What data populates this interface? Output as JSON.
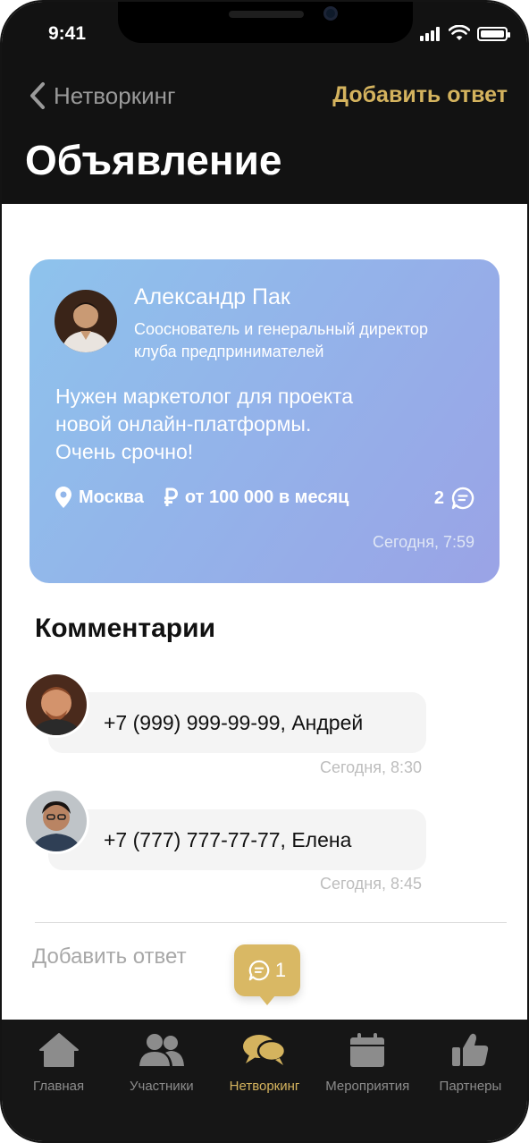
{
  "status_bar": {
    "time": "9:41"
  },
  "nav": {
    "back_label": "Нетворкинг",
    "action_label": "Добавить ответ",
    "title": "Объявление"
  },
  "post": {
    "author_name": "Александр Пак",
    "author_role": "Сооснователь и генеральный директор клуба предпринимателей",
    "text_lines": [
      "Нужен маркетолог для проекта",
      "новой онлайн-платформы.",
      "Очень срочно!"
    ],
    "location": "Москва",
    "salary": "от 100 000 в месяц",
    "comments_count": "2",
    "date": "Сегодня, 7:59",
    "icons": [
      "location-pin-icon",
      "ruble-icon",
      "comment-icon"
    ]
  },
  "comments": {
    "title": "Комментарии",
    "items": [
      {
        "text": "+7 (999) 999-99-99, Андрей",
        "date": "Сегодня, 8:30"
      },
      {
        "text": "+7 (777) 777-77-77, Елена",
        "date": "Сегодня, 8:45"
      }
    ]
  },
  "reply": {
    "placeholder": "Добавить ответ"
  },
  "fab": {
    "count": "1",
    "icon": "comment-icon"
  },
  "tabbar": {
    "items": [
      {
        "label": "Главная",
        "icon": "home-icon",
        "active": false
      },
      {
        "label": "Участники",
        "icon": "people-icon",
        "active": false
      },
      {
        "label": "Нетворкинг",
        "icon": "chat-bubbles-icon",
        "active": true
      },
      {
        "label": "Мероприятия",
        "icon": "calendar-icon",
        "active": false
      },
      {
        "label": "Партнеры",
        "icon": "thumbs-up-icon",
        "active": false
      }
    ]
  },
  "colors": {
    "accent": "#d4b35e",
    "header_bg": "#121212",
    "card_gradient_start": "#8ec3ec",
    "card_gradient_end": "#9aa3e6",
    "tab_inactive": "#8c8c8c"
  }
}
